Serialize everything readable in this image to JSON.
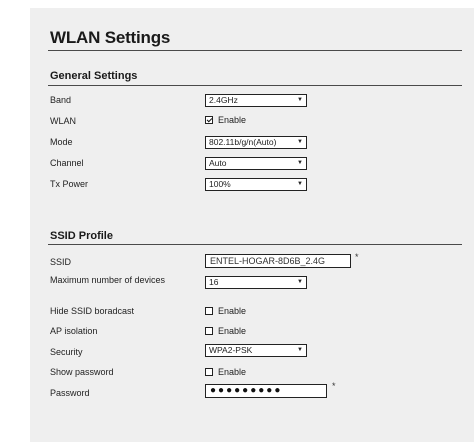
{
  "title": "WLAN Settings",
  "general": {
    "heading": "General Settings",
    "band": {
      "label": "Band",
      "value": "2.4GHz"
    },
    "wlan": {
      "label": "WLAN",
      "option": "Enable",
      "checked": true
    },
    "mode": {
      "label": "Mode",
      "value": "802.11b/g/n(Auto)"
    },
    "channel": {
      "label": "Channel",
      "value": "Auto"
    },
    "tx_power": {
      "label": "Tx Power",
      "value": "100%"
    }
  },
  "ssid_profile": {
    "heading": "SSID Profile",
    "ssid": {
      "label": "SSID",
      "value": "ENTEL-HOGAR-8D6B_2.4G",
      "required_mark": "*"
    },
    "max_devices": {
      "label": "Maximum number of devices",
      "value": "16"
    },
    "hide_ssid": {
      "label": "Hide SSID boradcast",
      "option": "Enable",
      "checked": false
    },
    "ap_isolation": {
      "label": "AP isolation",
      "option": "Enable",
      "checked": false
    },
    "security": {
      "label": "Security",
      "value": "WPA2-PSK"
    },
    "show_password": {
      "label": "Show password",
      "option": "Enable",
      "checked": false
    },
    "password": {
      "label": "Password",
      "value": "●●●●●●●●●",
      "required_mark": "*"
    }
  },
  "icons": {
    "dropdown": "chevron-down-icon",
    "checkbox": "checkbox-icon"
  }
}
